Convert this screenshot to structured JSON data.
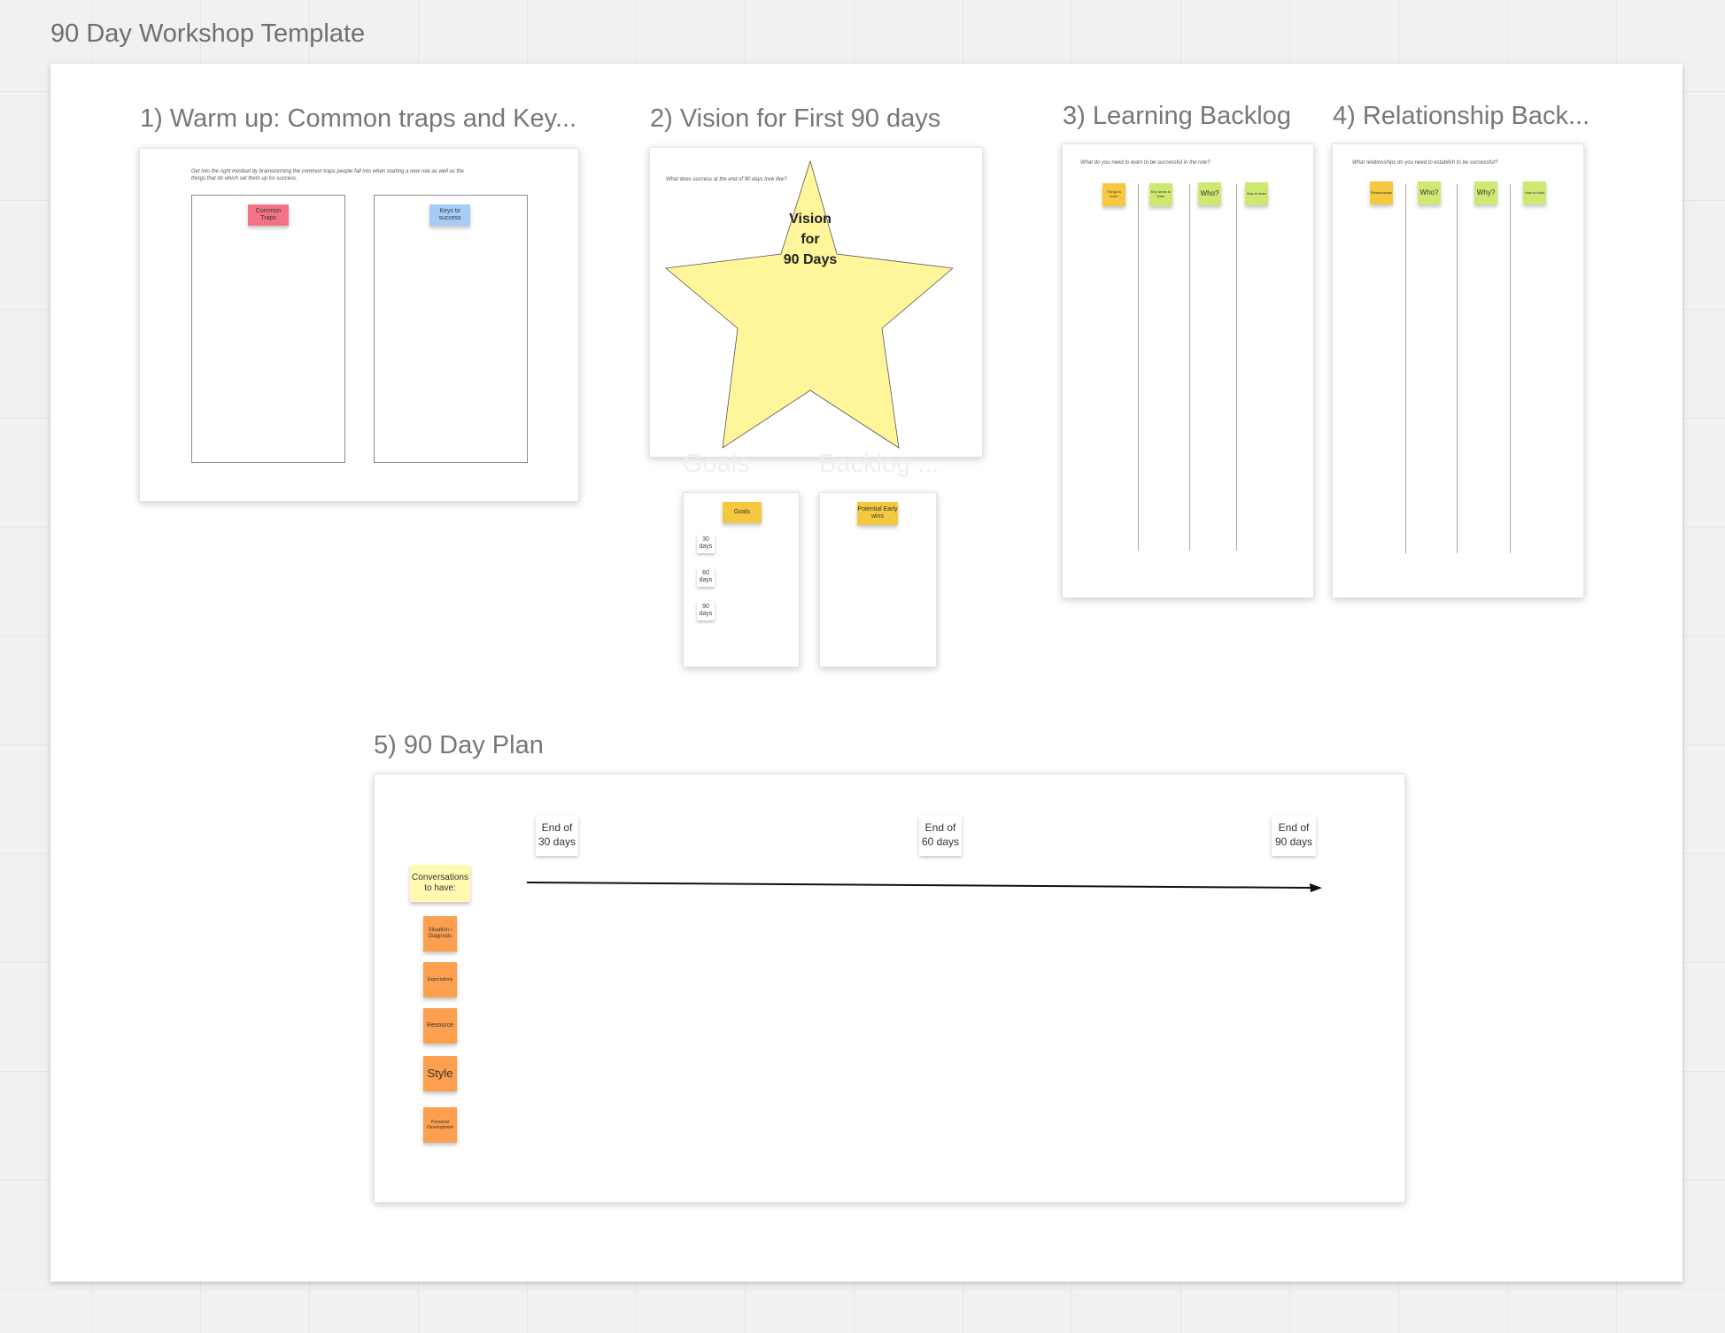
{
  "board": {
    "title": "90 Day Workshop Template"
  },
  "sections": {
    "warmup": {
      "title": "1) Warm up: Common traps and Key...",
      "instructions": "Get into the right mindset by brainstorming the common traps people fall into when starting a new role as well as the things that do which set them up for success.",
      "traps_label": "Common Traps",
      "keys_label": "Keys to success"
    },
    "vision": {
      "title": "2) Vision for First 90 days",
      "question": "What does success at the end of 90 days look like?",
      "star_line1": "Vision",
      "star_line2": "for",
      "star_line3": "90 Days"
    },
    "goals": {
      "ghost_title": "Goals",
      "label": "Goals",
      "chips": [
        "30 days",
        "60 days",
        "90 days"
      ]
    },
    "backlog": {
      "ghost_title": "Backlog ...",
      "label": "Potential Early wins"
    },
    "learning": {
      "title": "3) Learning Backlog",
      "question": "What do you need to learn to be successful in the role?",
      "stickies": [
        "Things to learn",
        "Key areas to learn",
        "Who?",
        "How to learn"
      ]
    },
    "relationship": {
      "title": "4) Relationship Back...",
      "question": "What relationships do you need to establish to be successful?",
      "stickies": [
        "Relationships",
        "Who?",
        "Why?",
        "How to build"
      ]
    },
    "plan": {
      "title": "5) 90 Day Plan",
      "milestones": [
        "End of 30 days",
        "End of 60 days",
        "End of 90 days"
      ],
      "conversations_label": "Conversations to have:",
      "topics": [
        "Situation / Diagnosis",
        "Expectations",
        "Resource",
        "Style",
        "Personal Development"
      ]
    }
  },
  "colors": {
    "pink_sticky": "#f27286",
    "blue_sticky": "#a6ccf5",
    "yellow_sticky": "#f5c93f",
    "lime_sticky": "#cfe872",
    "orange_sticky": "#fca04f",
    "pale_yellow_sticky": "#fff9b1",
    "star_fill": "#fff59b"
  }
}
